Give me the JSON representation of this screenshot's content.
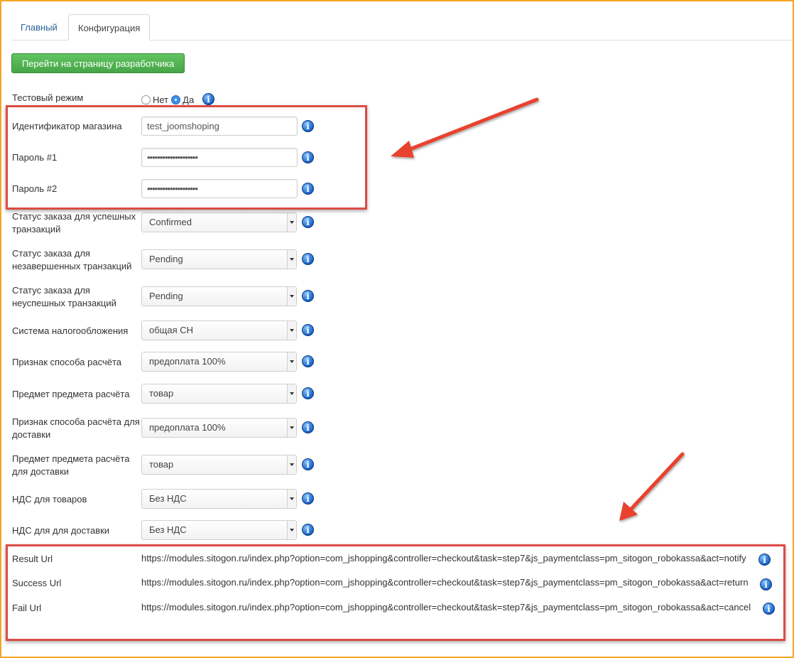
{
  "tabs": {
    "main": "Главный",
    "config": "Конфигурация"
  },
  "dev_button": "Перейти на страницу разработчика",
  "test_mode": {
    "label": "Тестовый режим",
    "no": "Нет",
    "yes": "Да",
    "selected": "Да"
  },
  "shop_id": {
    "label": "Идентификатор магазина",
    "value": "test_joomshoping"
  },
  "password1": {
    "label": "Пароль #1",
    "value": "••••••••••••••••••••"
  },
  "password2": {
    "label": "Пароль #2",
    "value": "••••••••••••••••••••"
  },
  "selects": [
    {
      "label": "Статус заказа для успешных транзакций",
      "value": "Confirmed"
    },
    {
      "label": "Статус заказа для незавершенных транзакций",
      "value": "Pending"
    },
    {
      "label": "Статус заказа для неуспешных транзакций",
      "value": "Pending"
    },
    {
      "label": "Система налогообложения",
      "value": "общая СН"
    },
    {
      "label": "Признак способа расчёта",
      "value": "предоплата 100%"
    },
    {
      "label": "Предмет предмета расчёта",
      "value": "товар"
    },
    {
      "label": "Признак способа расчёта для доставки",
      "value": "предоплата 100%"
    },
    {
      "label": "Предмет предмета расчёта для доставки",
      "value": "товар"
    },
    {
      "label": "НДС для товаров",
      "value": "Без НДС"
    },
    {
      "label": "НДС для для доставки",
      "value": "Без НДС"
    }
  ],
  "urls": [
    {
      "label": "Result Url",
      "value": "https://modules.sitogon.ru/index.php?option=com_jshopping&controller=checkout&task=step7&js_paymentclass=pm_sitogon_robokassa&act=notify"
    },
    {
      "label": "Success Url",
      "value": "https://modules.sitogon.ru/index.php?option=com_jshopping&controller=checkout&task=step7&js_paymentclass=pm_sitogon_robokassa&act=return"
    },
    {
      "label": "Fail Url",
      "value": "https://modules.sitogon.ru/index.php?option=com_jshopping&controller=checkout&task=step7&js_paymentclass=pm_sitogon_robokassa&act=cancel"
    }
  ],
  "icons": {
    "info": "info-icon",
    "arrow": "red-arrow-annotation"
  },
  "colors": {
    "annotation": "#dc4b45",
    "button": "#46a546",
    "frame": "#f5a623",
    "link": "#2a6496"
  }
}
